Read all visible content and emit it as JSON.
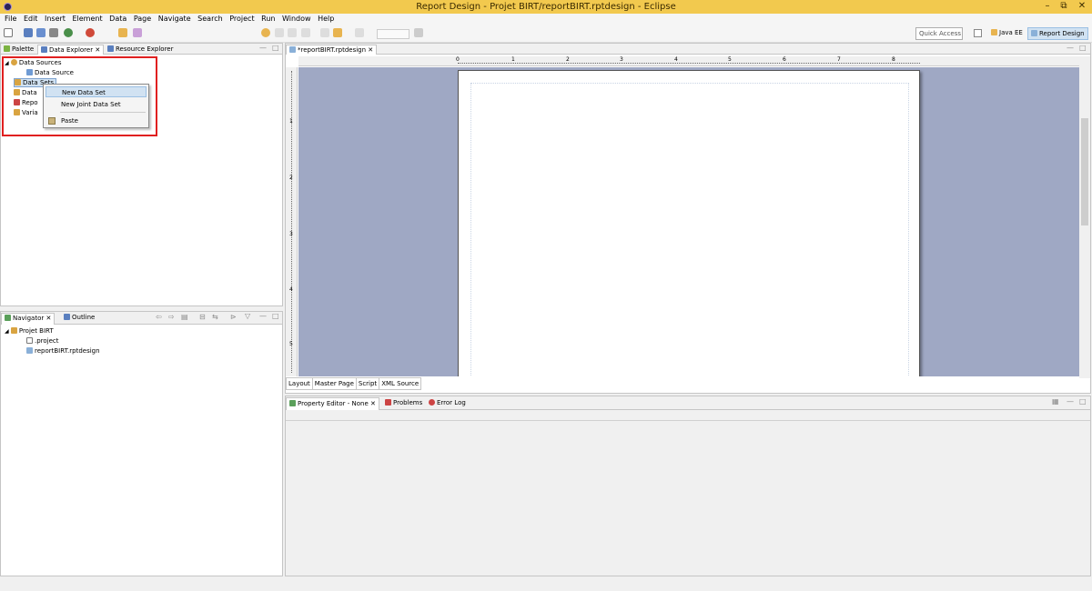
{
  "window": {
    "title": "Report Design - Projet BIRT/reportBIRT.rptdesign - Eclipse",
    "minimize": "–",
    "restore": "⧉",
    "close": "✕"
  },
  "menu": [
    "File",
    "Edit",
    "Insert",
    "Element",
    "Data",
    "Page",
    "Navigate",
    "Search",
    "Project",
    "Run",
    "Window",
    "Help"
  ],
  "toolbar": {
    "quick_access": "Quick Access",
    "perspectives": [
      "Java EE",
      "Report Design"
    ]
  },
  "left_top": {
    "tabs": [
      "Palette",
      "Data Explorer",
      "Resource Explorer"
    ],
    "tree": [
      {
        "label": "Data Sources"
      },
      {
        "label": "Data Source"
      },
      {
        "label": "Data Sets"
      },
      {
        "label": "Data"
      },
      {
        "label": "Repo"
      },
      {
        "label": "Varia"
      }
    ],
    "context_menu": [
      "New Data Set",
      "New Joint Data Set",
      "Paste"
    ]
  },
  "left_bottom": {
    "tabs": [
      "Navigator",
      "Outline"
    ],
    "tree": [
      {
        "label": "Projet BIRT"
      },
      {
        "label": ".project"
      },
      {
        "label": "reportBIRT.rptdesign"
      }
    ]
  },
  "editor": {
    "tab": "*reportBIRT.rptdesign",
    "ruler_h": [
      "0",
      "1",
      "2",
      "3",
      "4",
      "5",
      "6",
      "7",
      "8"
    ],
    "ruler_v": [
      "1",
      "2",
      "3",
      "4",
      "5"
    ],
    "bottom_tabs": [
      "Layout",
      "Master Page",
      "Script",
      "XML Source"
    ]
  },
  "bottom_panel": {
    "tabs": [
      "Property Editor - None",
      "Problems",
      "Error Log"
    ]
  },
  "colors": {
    "titlebar": "#f2c94e",
    "canvas": "#9fa8c4",
    "highlight_box": "#e02020"
  }
}
